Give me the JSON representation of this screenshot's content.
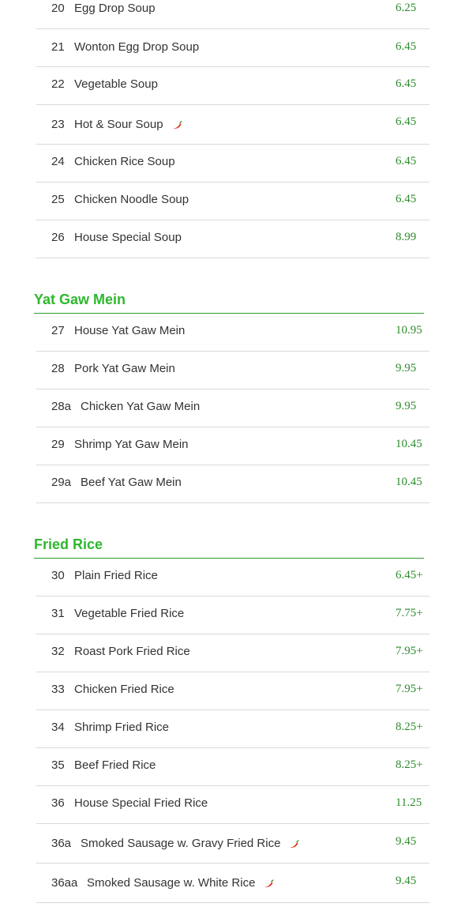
{
  "accent_color": "#2eb82e",
  "price_color": "#2e8b2e",
  "spicy_icon": "red-chili-pepper-icon",
  "soups": [
    {
      "num": "20",
      "name": "Egg Drop Soup",
      "price": "6.25",
      "spicy": false
    },
    {
      "num": "21",
      "name": "Wonton Egg Drop Soup",
      "price": "6.45",
      "spicy": false
    },
    {
      "num": "22",
      "name": "Vegetable Soup",
      "price": "6.45",
      "spicy": false
    },
    {
      "num": "23",
      "name": "Hot & Sour Soup",
      "price": "6.45",
      "spicy": true
    },
    {
      "num": "24",
      "name": "Chicken Rice Soup",
      "price": "6.45",
      "spicy": false
    },
    {
      "num": "25",
      "name": "Chicken Noodle Soup",
      "price": "6.45",
      "spicy": false
    },
    {
      "num": "26",
      "name": "House Special Soup",
      "price": "8.99",
      "spicy": false
    }
  ],
  "yat_gaw_mein": {
    "title": "Yat Gaw Mein",
    "items": [
      {
        "num": "27",
        "name": "House Yat Gaw Mein",
        "price": "10.95",
        "spicy": false
      },
      {
        "num": "28",
        "name": "Pork Yat Gaw Mein",
        "price": "9.95",
        "spicy": false
      },
      {
        "num": "28a",
        "name": "Chicken Yat Gaw Mein",
        "price": "9.95",
        "spicy": false
      },
      {
        "num": "29",
        "name": "Shrimp Yat Gaw Mein",
        "price": "10.45",
        "spicy": false
      },
      {
        "num": "29a",
        "name": "Beef Yat Gaw Mein",
        "price": "10.45",
        "spicy": false
      }
    ]
  },
  "fried_rice": {
    "title": "Fried Rice",
    "items": [
      {
        "num": "30",
        "name": "Plain Fried Rice",
        "price": "6.45+",
        "spicy": false
      },
      {
        "num": "31",
        "name": "Vegetable Fried Rice",
        "price": "7.75+",
        "spicy": false
      },
      {
        "num": "32",
        "name": "Roast Pork Fried Rice",
        "price": "7.95+",
        "spicy": false
      },
      {
        "num": "33",
        "name": "Chicken Fried Rice",
        "price": "7.95+",
        "spicy": false
      },
      {
        "num": "34",
        "name": "Shrimp Fried Rice",
        "price": "8.25+",
        "spicy": false
      },
      {
        "num": "35",
        "name": "Beef Fried Rice",
        "price": "8.25+",
        "spicy": false
      },
      {
        "num": "36",
        "name": "House Special Fried Rice",
        "price": "11.25",
        "spicy": false
      },
      {
        "num": "36a",
        "name": "Smoked Sausage w. Gravy Fried Rice",
        "price": "9.45",
        "spicy": true
      },
      {
        "num": "36aa",
        "name": "Smoked Sausage w. White Rice",
        "price": "9.45",
        "spicy": true
      }
    ]
  }
}
